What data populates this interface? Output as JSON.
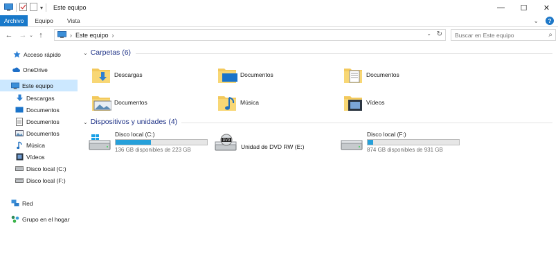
{
  "window": {
    "title": "Este equipo",
    "minimize": "—",
    "maximize": "☐",
    "close": "✕"
  },
  "ribbon": {
    "tabs": [
      "Archivo",
      "Equipo",
      "Vista"
    ],
    "help": "?"
  },
  "address": {
    "path": "Este equipo",
    "separator": "›",
    "search_placeholder": "Buscar en Este equipo"
  },
  "sidebar": {
    "items": [
      {
        "label": "Acceso rápido",
        "icon": "star-icon"
      },
      {
        "label": "OneDrive",
        "icon": "cloud-icon"
      },
      {
        "label": "Este equipo",
        "icon": "computer-icon",
        "selected": true
      },
      {
        "label": "Descargas",
        "icon": "download-arrow-icon"
      },
      {
        "label": "Documentos",
        "icon": "desktop-folder-icon"
      },
      {
        "label": "Documentos",
        "icon": "document-icon"
      },
      {
        "label": "Documentos",
        "icon": "pictures-icon"
      },
      {
        "label": "Música",
        "icon": "music-note-icon"
      },
      {
        "label": "Vídeos",
        "icon": "video-icon"
      },
      {
        "label": "Disco local (C:)",
        "icon": "drive-icon"
      },
      {
        "label": "Disco local (F:)",
        "icon": "drive-icon"
      },
      {
        "label": "Red",
        "icon": "network-icon"
      },
      {
        "label": "Grupo en el hogar",
        "icon": "homegroup-icon"
      }
    ]
  },
  "folders": {
    "heading": "Carpetas (6)",
    "items": [
      {
        "label": "Descargas",
        "icon": "downloads-folder-icon"
      },
      {
        "label": "Documentos",
        "icon": "desktop-folder-icon"
      },
      {
        "label": "Documentos",
        "icon": "documents-folder-icon"
      },
      {
        "label": "Documentos",
        "icon": "pictures-folder-icon"
      },
      {
        "label": "Música",
        "icon": "music-folder-icon"
      },
      {
        "label": "Vídeos",
        "icon": "videos-folder-icon"
      }
    ]
  },
  "devices": {
    "heading": "Dispositivos y unidades (4)",
    "items": [
      {
        "label": "Disco local (C:)",
        "free": "136 GB disponibles de 223 GB",
        "used_fraction": 0.39,
        "icon": "windows-drive-icon"
      },
      {
        "label": "Unidad de DVD RW (E:)",
        "free": "",
        "icon": "dvd-drive-icon"
      },
      {
        "label": "Disco local (F:)",
        "free": "874 GB disponibles de 931 GB",
        "used_fraction": 0.06,
        "icon": "drive-icon"
      }
    ]
  },
  "colors": {
    "accent": "#1979ca",
    "selection": "#cce8ff",
    "bar_fill": "#26a0da",
    "heading": "#1e3287",
    "folder": "#f3c95c"
  }
}
